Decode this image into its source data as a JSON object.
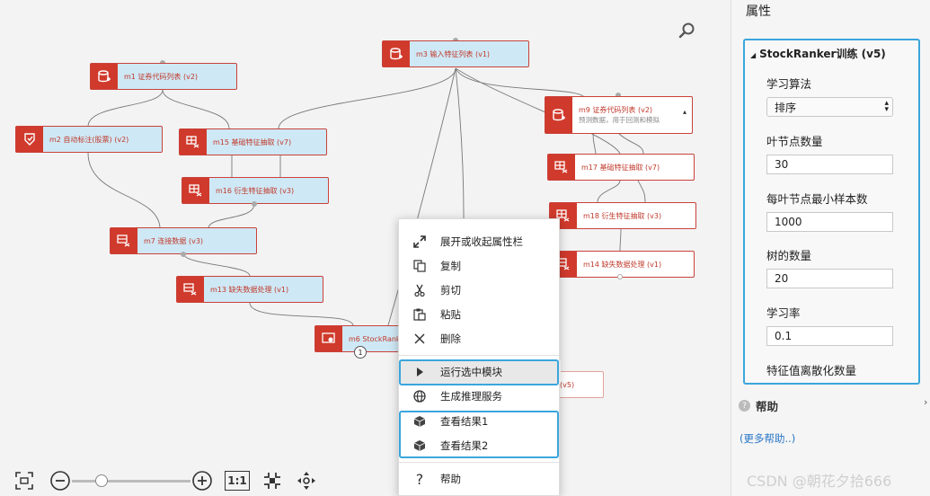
{
  "canvas": {
    "nodes": {
      "m1": {
        "label": "m1 证券代码列表 (v2)"
      },
      "m2": {
        "label": "m2 自动标注(股票) (v2)"
      },
      "m3": {
        "label": "m3 输入特征列表 (v1)"
      },
      "m15": {
        "label": "m15 基础特征抽取 (v7)"
      },
      "m16": {
        "label": "m16 衍生特征抽取 (v3)"
      },
      "m7": {
        "label": "m7 连接数据 (v3)"
      },
      "m13": {
        "label": "m13 缺失数据处理 (v1)"
      },
      "m6": {
        "label": "m6 StockRanker"
      },
      "m9": {
        "label": "m9 证券代码列表 (v2)",
        "sub": "预测数据，用于回测和模拟"
      },
      "m17": {
        "label": "m17 基础特征抽取 (v7)"
      },
      "m18": {
        "label": "m18 衍生特征抽取 (v3)"
      },
      "m14": {
        "label": "m14 缺失数据处理 (v1)"
      },
      "hidden_node": {
        "label": "(v5)"
      }
    },
    "m6_badge": "1",
    "toolbar": {
      "one_to_one": "1:1",
      "zoom_level": 0.25
    }
  },
  "context_menu": {
    "items": [
      {
        "label": "展开或收起属性栏",
        "icon": "expand-icon"
      },
      {
        "label": "复制",
        "icon": "copy-icon"
      },
      {
        "label": "剪切",
        "icon": "scissors-icon"
      },
      {
        "label": "粘贴",
        "icon": "paste-icon"
      },
      {
        "label": "删除",
        "icon": "close-icon"
      },
      {
        "label": "运行选中模块",
        "icon": "play-icon"
      },
      {
        "label": "生成推理服务",
        "icon": "globe-icon"
      },
      {
        "label": "查看结果1",
        "icon": "cube-icon"
      },
      {
        "label": "查看结果2",
        "icon": "cube-icon"
      },
      {
        "label": "帮助",
        "icon": "question-icon"
      }
    ]
  },
  "panel": {
    "title": "属性",
    "section_title": "StockRanker训练 (v5)",
    "fields": {
      "algorithm": {
        "label": "学习算法",
        "value": "排序"
      },
      "leaves": {
        "label": "叶节点数量",
        "value": "30"
      },
      "min_samples": {
        "label": "每叶节点最小样本数",
        "value": "1000"
      },
      "trees": {
        "label": "树的数量",
        "value": "20"
      },
      "learning_rate": {
        "label": "学习率",
        "value": "0.1"
      },
      "discretize": {
        "label": "特征值离散化数量"
      }
    },
    "help": {
      "title": "帮助",
      "link": "(更多帮助..)"
    }
  },
  "watermark": "CSDN @朝花夕拾666",
  "colors": {
    "accent": "#3aa6dd",
    "node_icon": "#d03a2c",
    "node_fill": "#cfe8f5",
    "link": "#2a76c6"
  }
}
